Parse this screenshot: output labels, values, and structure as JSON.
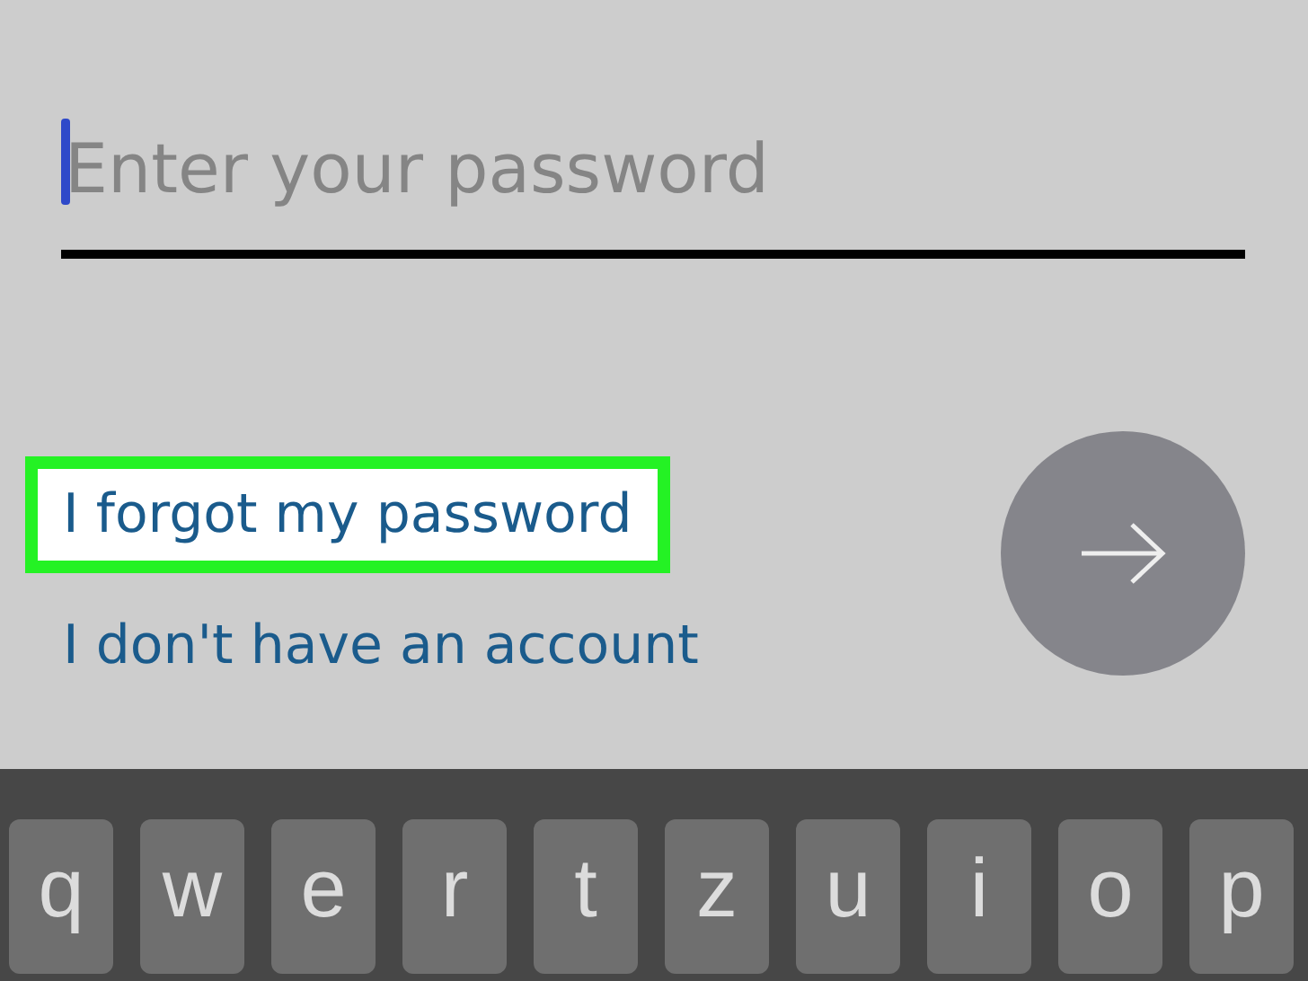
{
  "password_field": {
    "placeholder": "Enter your password",
    "focused": true
  },
  "links": [
    {
      "label": "I forgot my password",
      "highlighted": true
    },
    {
      "label": "I don't have an account",
      "highlighted": false
    }
  ],
  "next_button": {
    "disabled": true
  },
  "keyboard": {
    "keys": [
      "q",
      "w",
      "e",
      "r",
      "t",
      "z",
      "u",
      "i",
      "o",
      "p"
    ]
  }
}
